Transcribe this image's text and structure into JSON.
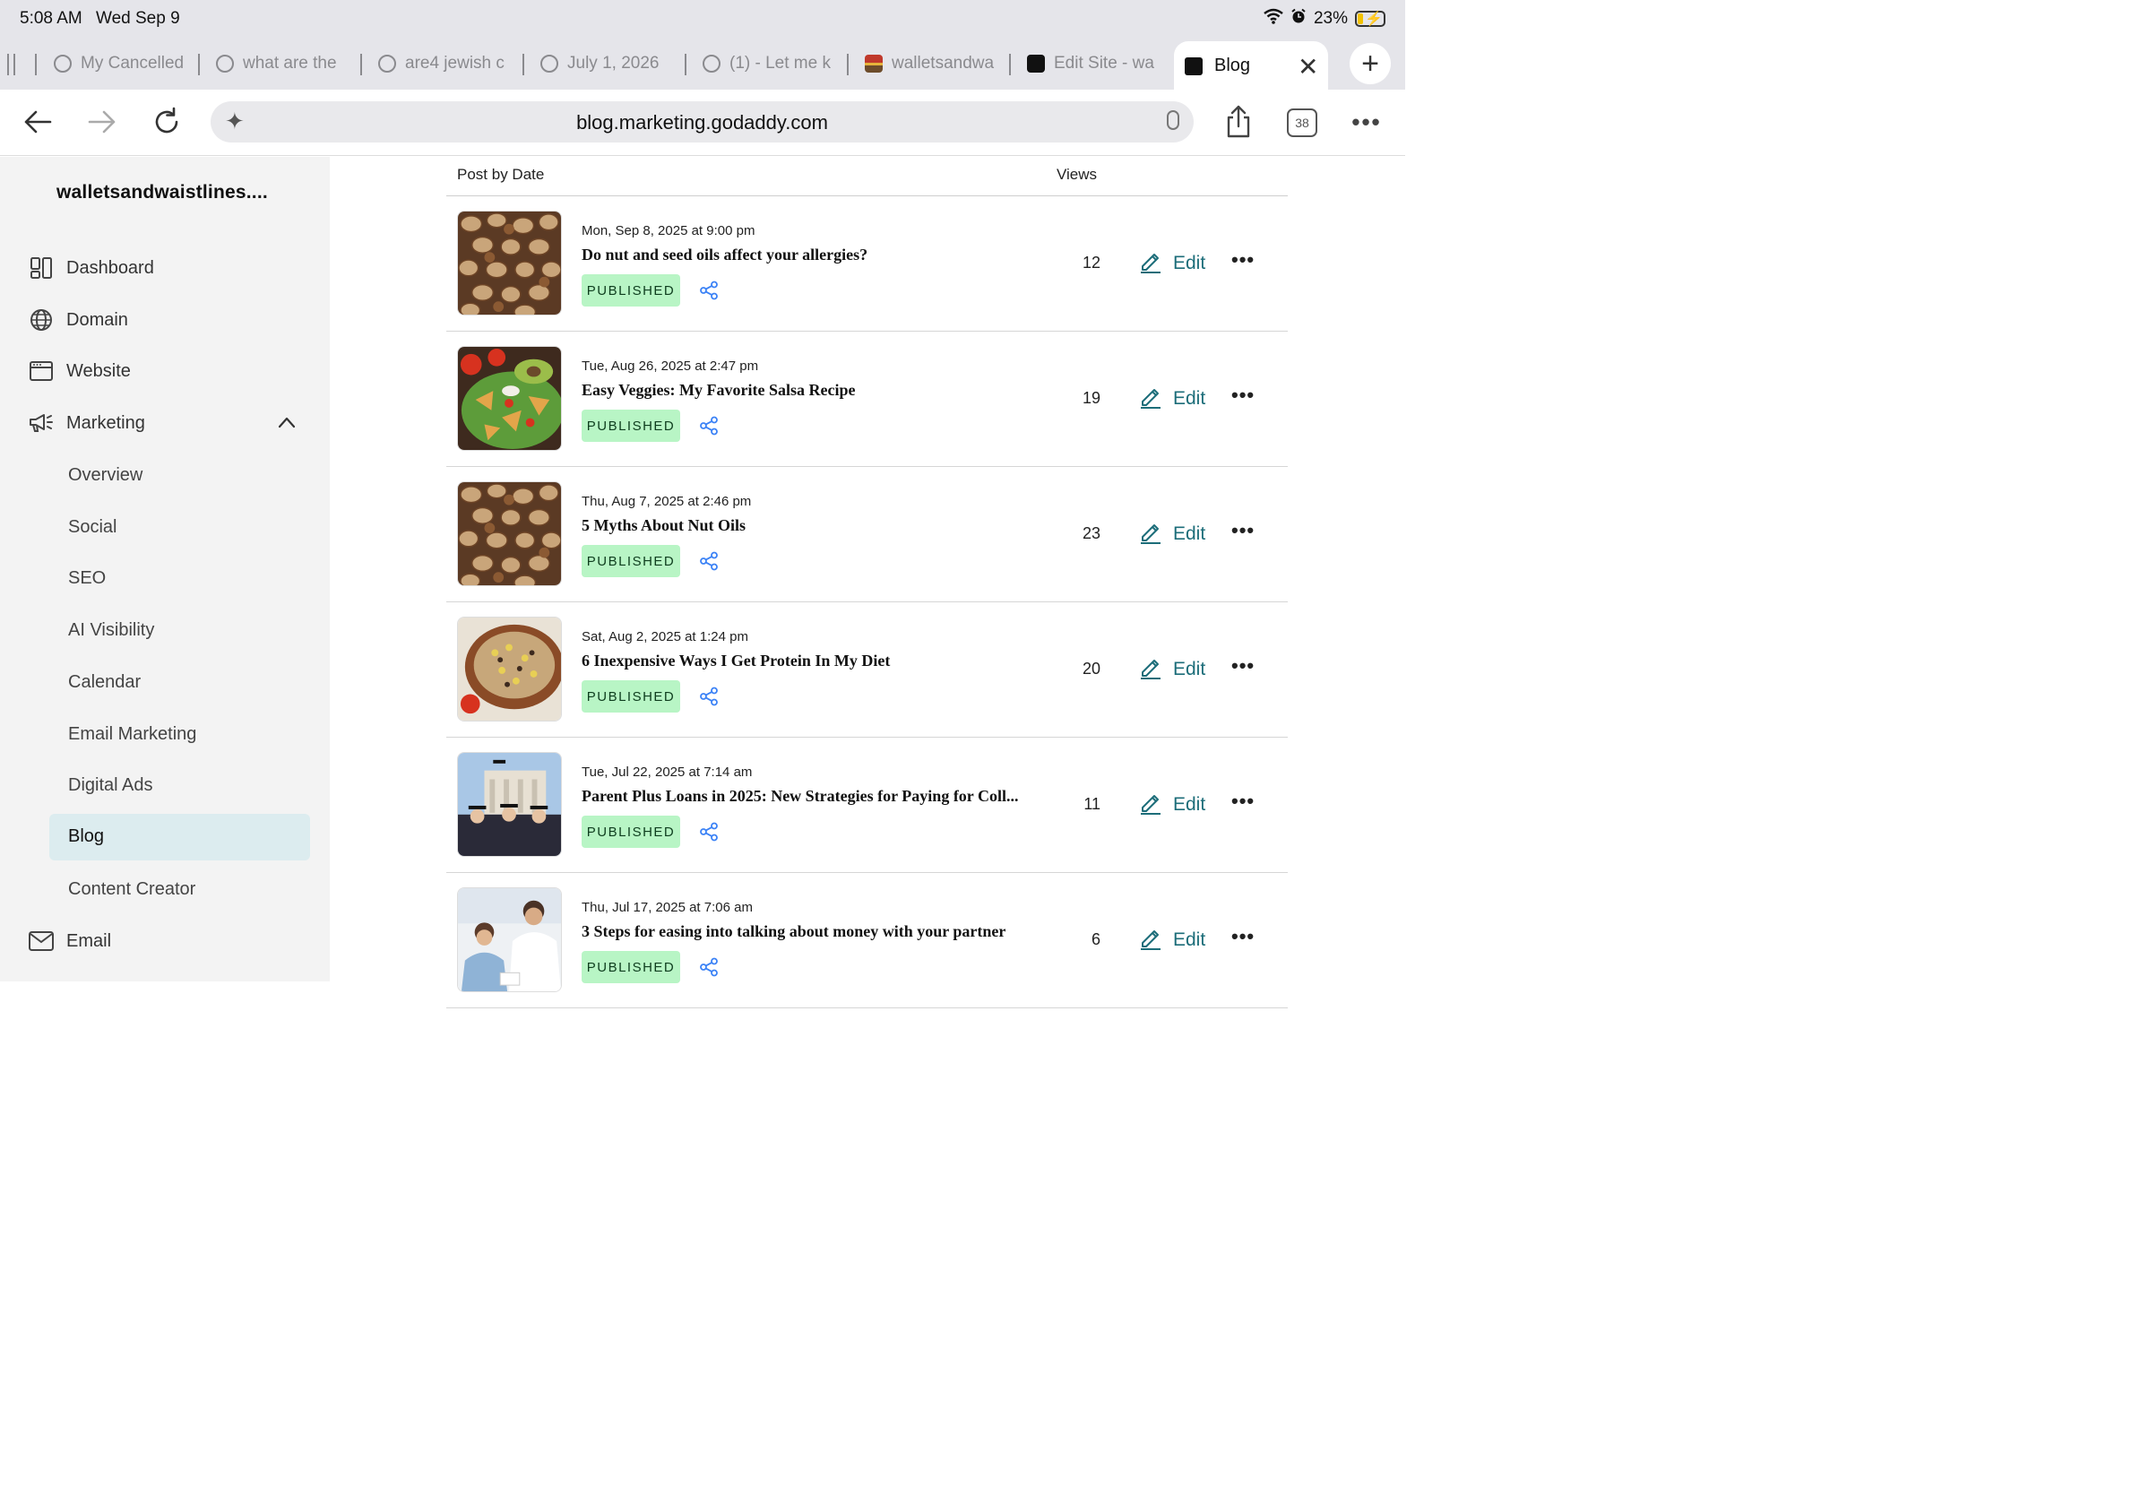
{
  "status": {
    "time": "5:08 AM",
    "date": "Wed Sep 9",
    "battery": "23%",
    "battery_level": 0.23
  },
  "tabs": [
    {
      "label": "My Cancelled"
    },
    {
      "label": "what are the"
    },
    {
      "label": "are4 jewish c"
    },
    {
      "label": "July 1, 2026"
    },
    {
      "label": "(1) - Let me k"
    },
    {
      "label": "walletsandwa"
    },
    {
      "label": "Edit Site - wa"
    }
  ],
  "active_tab": {
    "label": "Blog"
  },
  "address": {
    "url": "blog.marketing.godaddy.com",
    "tab_count": "38"
  },
  "sidebar": {
    "site_name": "walletsandwaistlines....",
    "items": [
      {
        "label": "Dashboard",
        "icon": "dashboard-icon"
      },
      {
        "label": "Domain",
        "icon": "globe-icon"
      },
      {
        "label": "Website",
        "icon": "browser-window-icon"
      },
      {
        "label": "Marketing",
        "icon": "megaphone-icon"
      }
    ],
    "marketing_sub": [
      {
        "label": "Overview"
      },
      {
        "label": "Social"
      },
      {
        "label": "SEO"
      },
      {
        "label": "AI Visibility"
      },
      {
        "label": "Calendar"
      },
      {
        "label": "Email Marketing"
      },
      {
        "label": "Digital Ads"
      },
      {
        "label": "Blog"
      },
      {
        "label": "Content Creator"
      }
    ],
    "email": {
      "label": "Email",
      "icon": "mail-icon"
    }
  },
  "table": {
    "col_post": "Post by Date",
    "col_views": "Views",
    "edit_label": "Edit",
    "rows": [
      {
        "date": "Mon, Sep 8, 2025 at 9:00 pm",
        "title": "Do nut and seed oils affect your allergies?",
        "status": "PUBLISHED",
        "views": "12",
        "thumb": "nuts"
      },
      {
        "date": "Tue, Aug 26, 2025 at 2:47 pm",
        "title": "Easy Veggies: My Favorite Salsa Recipe",
        "status": "PUBLISHED",
        "views": "19",
        "thumb": "salsa"
      },
      {
        "date": "Thu, Aug 7, 2025 at 2:46 pm",
        "title": "5 Myths About Nut Oils",
        "status": "PUBLISHED",
        "views": "23",
        "thumb": "nuts"
      },
      {
        "date": "Sat, Aug 2, 2025 at 1:24 pm",
        "title": "6 Inexpensive Ways I Get Protein In My Diet",
        "status": "PUBLISHED",
        "views": "20",
        "thumb": "beans"
      },
      {
        "date": "Tue, Jul 22, 2025 at 7:14 am",
        "title": "Parent Plus Loans in 2025: New Strategies for Paying for Coll...",
        "status": "PUBLISHED",
        "views": "11",
        "thumb": "graduates"
      },
      {
        "date": "Thu, Jul 17, 2025 at 7:06 am",
        "title": "3 Steps for easing into talking about money with your partner",
        "status": "PUBLISHED",
        "views": "6",
        "thumb": "couple"
      }
    ]
  },
  "colors": {
    "accent": "#1c6d79",
    "badge_bg": "#b8f5c5",
    "sidebar_active": "#dcecef",
    "share_icon": "#3b82f6"
  }
}
